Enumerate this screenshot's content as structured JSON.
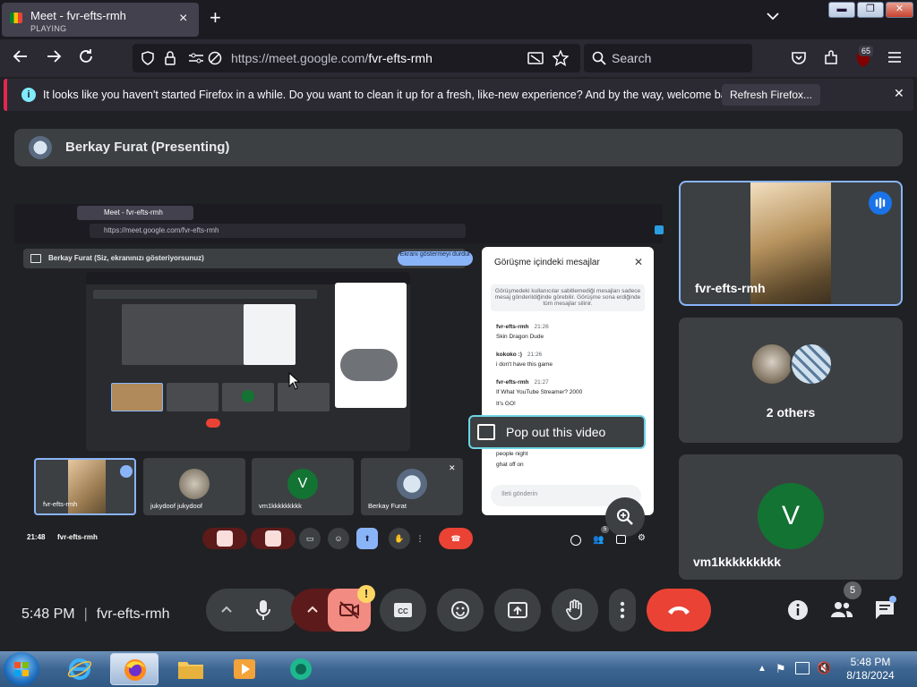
{
  "browser": {
    "tab": {
      "title": "Meet - fvr-efts-rmh",
      "subtitle": "PLAYING"
    },
    "url": {
      "host": "https://meet.google.com/",
      "path": "fvr-efts-rmh"
    },
    "search_placeholder": "Search",
    "extension_badge": "65",
    "notice": {
      "message": "It looks like you haven't started Firefox in a while. Do you want to clean it up for a fresh, like-new experience? And by the way, welcome back!",
      "button": "Refresh Firefox..."
    }
  },
  "meet": {
    "presenter_label": "Berkay Furat (Presenting)",
    "shared": {
      "tab_title": "Meet - fvr-efts-rmh",
      "url": "https://meet.google.com/fvr-efts-rmh",
      "presenting_text": "Berkay Furat (Siz, ekranınızı gösteriyorsunuz)",
      "stop_button": "Ekranı göstermeyi durdur",
      "chat": {
        "title": "Görüşme içindeki mesajlar",
        "note": "Görüşmedeki kullanıcılar sabitlemediği mesajları sadece mesaj gönderildiğinde görebilir. Görüşme sona erdiğinde tüm mesajlar silinir.",
        "messages": [
          {
            "author": "fvr-efts-rmh",
            "time": "21:26",
            "text": "Skin Dragon Dude"
          },
          {
            "author": "kokoko :)",
            "time": "21:26",
            "text": "i don't have this game"
          },
          {
            "author": "fvr-efts-rmh",
            "time": "21:27",
            "text": "If What YouTube Streamer? 2000"
          },
          {
            "author": "",
            "time": "",
            "text": "It's GO!"
          },
          {
            "author": "",
            "time": "",
            "text": "people night"
          },
          {
            "author": "",
            "time": "",
            "text": "ghat off on"
          }
        ],
        "send_placeholder": "Ileti gönderin"
      },
      "popout_label": "Pop out this video",
      "tiles": [
        {
          "name": "fvr-efts-rmh"
        },
        {
          "name": "jukydoof jukydoof"
        },
        {
          "name": "vm1kkkkkkkkk",
          "initial": "V"
        },
        {
          "name": "Berkay Furat"
        }
      ],
      "footer_time": "21:48",
      "footer_code": "fvr-efts-rmh",
      "people_count": "5"
    },
    "side_tiles": [
      {
        "name": "fvr-efts-rmh"
      },
      {
        "name": "2 others"
      },
      {
        "name": "vm1kkkkkkkkk",
        "initial": "V"
      }
    ],
    "bottom": {
      "time": "5:48 PM",
      "code": "fvr-efts-rmh",
      "people_count": "5",
      "alert": "!"
    }
  },
  "taskbar": {
    "time": "5:48 PM",
    "date": "8/18/2024"
  },
  "colors": {
    "accent_blue": "#8ab4f8",
    "leave_red": "#ea4335",
    "cam_off_red": "#f9dedc",
    "avatar_green": "#137333"
  }
}
